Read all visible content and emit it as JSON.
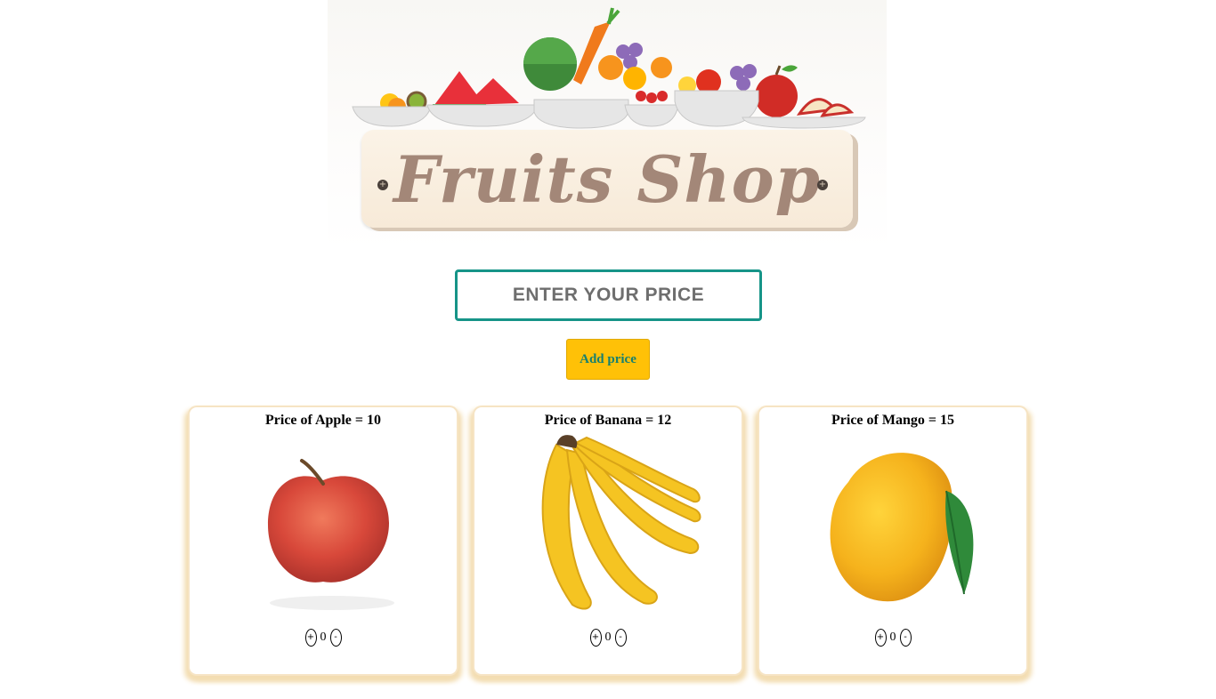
{
  "banner": {
    "title": "Fruits Shop"
  },
  "price_input": {
    "placeholder": "ENTER YOUR PRICE",
    "value": ""
  },
  "add_button": {
    "label": "Add price"
  },
  "cards": [
    {
      "label": "Price of Apple",
      "eq": " = ",
      "price": "10",
      "count": "0",
      "plus": "+",
      "minus": "-"
    },
    {
      "label": "Price of Banana",
      "eq": " = ",
      "price": "12",
      "count": "0",
      "plus": "+",
      "minus": "-"
    },
    {
      "label": "Price of Mango",
      "eq": " = ",
      "price": "15",
      "count": "0",
      "plus": "+",
      "minus": "-"
    }
  ],
  "colors": {
    "accent": "#169488",
    "button": "#ffc107",
    "card_glow": "#f3ddb2",
    "sign_text": "#a38778"
  }
}
